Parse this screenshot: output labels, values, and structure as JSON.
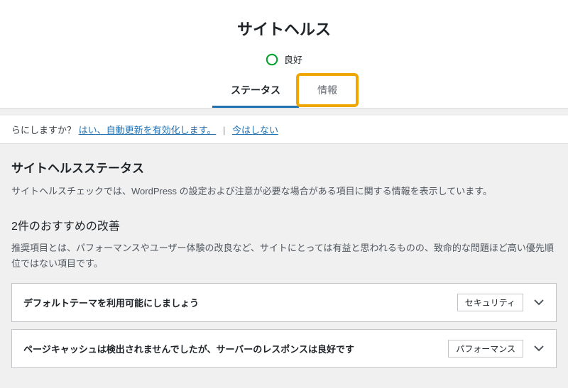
{
  "header": {
    "title": "サイトヘルス",
    "status_label": "良好"
  },
  "tabs": {
    "status": "ステータス",
    "info": "情報"
  },
  "notice": {
    "question_fragment": "らにしますか？",
    "enable_link": "はい、自動更新を有効化します。",
    "later_link": "今はしない"
  },
  "status_section": {
    "title": "サイトヘルスステータス",
    "desc": "サイトヘルスチェックでは、WordPress の設定および注意が必要な場合がある項目に関する情報を表示しています。"
  },
  "improvements": {
    "title": "2件のおすすめの改善",
    "desc": "推奨項目とは、パフォーマンスやユーザー体験の改良など、サイトにとっては有益と思われるものの、致命的な問題ほど高い優先順位ではない項目です。"
  },
  "check_items": [
    {
      "title": "デフォルトテーマを利用可能にしましょう",
      "badge": "セキュリティ"
    },
    {
      "title": "ページキャッシュは検出されませんでしたが、サーバーのレスポンスは良好です",
      "badge": "パフォーマンス"
    }
  ]
}
